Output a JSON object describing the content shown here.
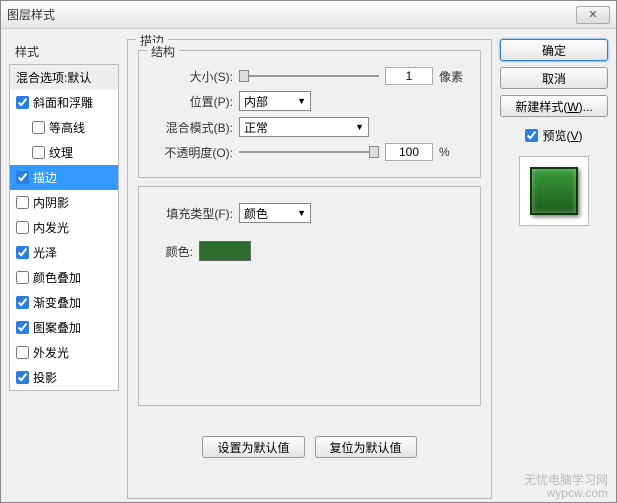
{
  "dialog": {
    "title": "图层样式",
    "close": "✕"
  },
  "sidebar": {
    "header": "样式",
    "blending": "混合选项:默认",
    "items": [
      {
        "label": "斜面和浮雕",
        "checked": true,
        "indent": false
      },
      {
        "label": "等高线",
        "checked": false,
        "indent": true
      },
      {
        "label": "纹理",
        "checked": false,
        "indent": true
      },
      {
        "label": "描边",
        "checked": true,
        "indent": false,
        "selected": true
      },
      {
        "label": "内阴影",
        "checked": false,
        "indent": false
      },
      {
        "label": "内发光",
        "checked": false,
        "indent": false
      },
      {
        "label": "光泽",
        "checked": true,
        "indent": false
      },
      {
        "label": "颜色叠加",
        "checked": false,
        "indent": false
      },
      {
        "label": "渐变叠加",
        "checked": true,
        "indent": false
      },
      {
        "label": "图案叠加",
        "checked": true,
        "indent": false
      },
      {
        "label": "外发光",
        "checked": false,
        "indent": false
      },
      {
        "label": "投影",
        "checked": true,
        "indent": false
      }
    ]
  },
  "panel": {
    "title": "描边",
    "structure": {
      "title": "结构",
      "size_label": "大小(S):",
      "size_value": "1",
      "size_unit": "像素",
      "position_label": "位置(P):",
      "position_value": "内部",
      "blend_label": "混合模式(B):",
      "blend_value": "正常",
      "opacity_label": "不透明度(O):",
      "opacity_value": "100",
      "opacity_unit": "%"
    },
    "fill": {
      "type_label": "填充类型(F):",
      "type_value": "颜色",
      "color_label": "颜色:",
      "color_value": "#2e6b2e"
    },
    "defaults": {
      "set": "设置为默认值",
      "reset": "复位为默认值"
    }
  },
  "right": {
    "ok": "确定",
    "cancel": "取消",
    "new_style": "新建样式(W)...",
    "preview_label": "预览(V)",
    "preview_checked": true
  },
  "watermark": {
    "line1": "无忧电脑学习网",
    "line2": "wypcw.com"
  }
}
